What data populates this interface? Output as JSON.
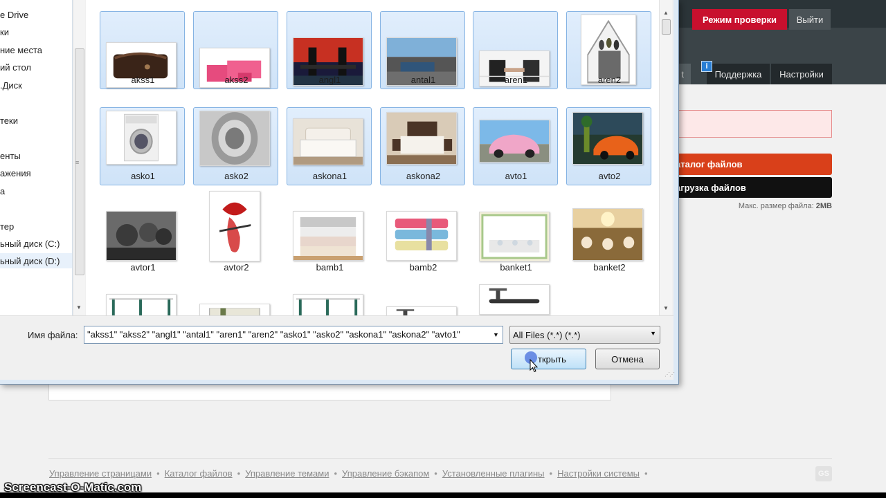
{
  "header": {
    "review_mode_label": "Режим проверки",
    "logout_label": "Выйти",
    "info_icon_text": "i",
    "tabs": [
      {
        "label": "Поддержка"
      },
      {
        "label": "Настройки"
      }
    ],
    "partial_tab_fragment": "t"
  },
  "sidebar_right": {
    "catalog_button": "аталог файлов",
    "upload_button": "агрузка файлов",
    "max_size_label": "Макс. размер файла:",
    "max_size_value": "2MB"
  },
  "footer": {
    "links": [
      "Управление страницами",
      "Каталог файлов",
      "Управление темами",
      "Управление бэкапом",
      "Установленные плагины",
      "Настройки системы"
    ],
    "separator": "•",
    "logo_text": "GS"
  },
  "watermark": "Screencast-O-Matic.com",
  "dialog": {
    "nav_items": [
      {
        "label": "e Drive",
        "selected": false
      },
      {
        "label": "ки",
        "selected": false
      },
      {
        "label": "ние места",
        "selected": false
      },
      {
        "label": "ий стол",
        "selected": false
      },
      {
        "label": ".Диск",
        "selected": false
      },
      {
        "label": "",
        "selected": false
      },
      {
        "label": "теки",
        "selected": false
      },
      {
        "label": "",
        "selected": false
      },
      {
        "label": "енты",
        "selected": false
      },
      {
        "label": "ажения",
        "selected": false
      },
      {
        "label": "а",
        "selected": false
      },
      {
        "label": "",
        "selected": false
      },
      {
        "label": "тер",
        "selected": false
      },
      {
        "label": "ьный диск (C:)",
        "selected": false
      },
      {
        "label": "ьный диск (D:)",
        "selected": true
      }
    ],
    "files": [
      {
        "name": "akss1",
        "selected": true,
        "thumb": "purse-icon"
      },
      {
        "name": "akss2",
        "selected": true,
        "thumb": "pink-bag-icon"
      },
      {
        "name": "angl1",
        "selected": true,
        "thumb": "tower-bridge-icon"
      },
      {
        "name": "antal1",
        "selected": true,
        "thumb": "bay-city-icon"
      },
      {
        "name": "aren1",
        "selected": true,
        "thumb": "handshake-icon"
      },
      {
        "name": "aren2",
        "selected": true,
        "thumb": "family-house-icon"
      },
      {
        "name": "asko1",
        "selected": true,
        "thumb": "washing-machine-icon"
      },
      {
        "name": "asko2",
        "selected": true,
        "thumb": "drum-icon"
      },
      {
        "name": "askona1",
        "selected": true,
        "thumb": "white-bed-icon"
      },
      {
        "name": "askona2",
        "selected": true,
        "thumb": "bedroom-icon"
      },
      {
        "name": "avto1",
        "selected": true,
        "thumb": "pink-car-icon"
      },
      {
        "name": "avto2",
        "selected": true,
        "thumb": "orange-car-icon"
      },
      {
        "name": "avtor1",
        "selected": false,
        "thumb": "portrait-photo-icon"
      },
      {
        "name": "avtor2",
        "selected": false,
        "thumb": "lips-art-icon"
      },
      {
        "name": "bamb1",
        "selected": false,
        "thumb": "towels-light-icon"
      },
      {
        "name": "bamb2",
        "selected": false,
        "thumb": "towels-color-icon"
      },
      {
        "name": "banket1",
        "selected": false,
        "thumb": "banquet-hall-icon"
      },
      {
        "name": "banket2",
        "selected": false,
        "thumb": "banquet-gold-icon"
      },
      {
        "name": "",
        "selected": false,
        "thumb": "shelf-icon"
      },
      {
        "name": "",
        "selected": false,
        "thumb": "box-icon"
      },
      {
        "name": "",
        "selected": false,
        "thumb": "shelf-icon"
      },
      {
        "name": "",
        "selected": false,
        "thumb": "treadmill-icon"
      },
      {
        "name": "",
        "selected": false,
        "thumb": "treadmill-icon"
      }
    ],
    "filename_label": "Имя файла:",
    "filename_value": "\"akss1\" \"akss2\" \"angl1\" \"antal1\" \"aren1\" \"aren2\" \"asko1\" \"asko2\" \"askona1\" \"askona2\" \"avto1\"",
    "filter_value": "All Files (*.*) (*.*)",
    "open_label": "ткрыть",
    "cancel_label": "Отмена"
  },
  "colors": {
    "selection_bg": "#cfe3f8",
    "selection_border": "#85b3e3",
    "accent_red": "#c8102e",
    "catalog_orange": "#d9401a"
  }
}
